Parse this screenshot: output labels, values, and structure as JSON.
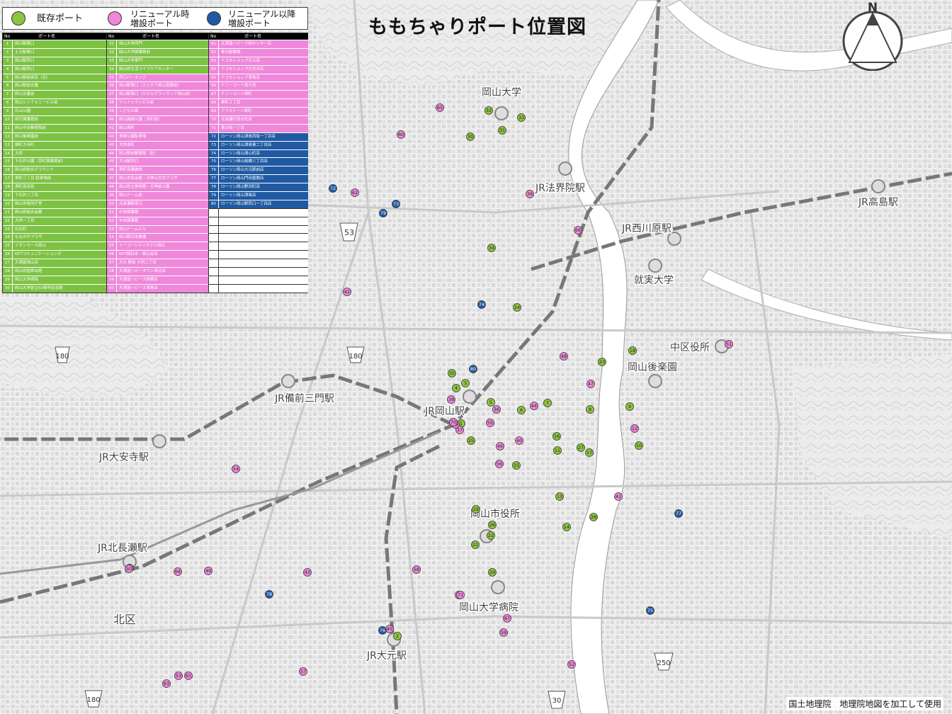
{
  "title": "ももちゃりポート位置図",
  "credit": "国土地理院　地理院地図を加工して使用",
  "legend": [
    {
      "label": "既存ポート",
      "color": "#8cc63f"
    },
    {
      "label": "リニューアル時\n増設ポート",
      "color": "#ef87da"
    },
    {
      "label": "リニューアル以降\n増設ポート",
      "color": "#1f5aa3"
    }
  ],
  "compass_letter": "N",
  "table_header": {
    "no": "No",
    "name": "ポート名"
  },
  "table": {
    "col1": [
      {
        "no": "1",
        "name": "岡山駅東口",
        "c": "green"
      },
      {
        "no": "2",
        "name": "土元駅東口",
        "c": "green"
      },
      {
        "no": "3",
        "name": "岡山駅西口",
        "c": "green"
      },
      {
        "no": "4",
        "name": "岡山駅西口",
        "c": "green"
      },
      {
        "no": "5",
        "name": "岡山駅前商店（北）",
        "c": "green"
      },
      {
        "no": "6",
        "name": "岡山駅前交番",
        "c": "green"
      },
      {
        "no": "7",
        "name": "岡山交番前",
        "c": "green"
      },
      {
        "no": "8",
        "name": "岡山シンフォニービル前",
        "c": "green"
      },
      {
        "no": "9",
        "name": "石山公園",
        "c": "green"
      },
      {
        "no": "10",
        "name": "県庁図書館前",
        "c": "green"
      },
      {
        "no": "11",
        "name": "岡山中央郵便局前",
        "c": "green"
      },
      {
        "no": "12",
        "name": "岡山後楽園前",
        "c": "green"
      },
      {
        "no": "13",
        "name": "柳町大寺町",
        "c": "green"
      },
      {
        "no": "14",
        "name": "大供",
        "c": "green"
      },
      {
        "no": "15",
        "name": "下石井公園（幸町図書館前）",
        "c": "green"
      },
      {
        "no": "16",
        "name": "岡山県総合グラウンド",
        "c": "green"
      },
      {
        "no": "17",
        "name": "表町三丁目 駐車場前",
        "c": "green"
      },
      {
        "no": "18",
        "name": "表町商店街",
        "c": "green"
      },
      {
        "no": "19",
        "name": "下石井二丁目",
        "c": "green"
      },
      {
        "no": "20",
        "name": "岡山市役所庁舎",
        "c": "green"
      },
      {
        "no": "21",
        "name": "岡山県総合会館",
        "c": "green"
      },
      {
        "no": "22",
        "name": "大供一丁目",
        "c": "green"
      },
      {
        "no": "23",
        "name": "石石町",
        "c": "green"
      },
      {
        "no": "24",
        "name": "もものやプラザ",
        "c": "green"
      },
      {
        "no": "25",
        "name": "イオンモール岡山",
        "c": "green"
      },
      {
        "no": "26",
        "name": "NTTコミュニケーションズ",
        "c": "green"
      },
      {
        "no": "27",
        "name": "天満屋岡山店",
        "c": "green"
      },
      {
        "no": "28",
        "name": "岡山県医師会館",
        "c": "green"
      },
      {
        "no": "29",
        "name": "岡山大学病院",
        "c": "green"
      },
      {
        "no": "30",
        "name": "岡山大学創立50周年記念館",
        "c": "green"
      }
    ],
    "col2": [
      {
        "no": "31",
        "name": "岡山大学西門",
        "c": "green"
      },
      {
        "no": "32",
        "name": "岡山大学図書館前",
        "c": "green"
      },
      {
        "no": "33",
        "name": "岡山大学東門",
        "c": "green"
      },
      {
        "no": "34",
        "name": "岡山県生活ライフケアセンター",
        "c": "green"
      },
      {
        "no": "35",
        "name": "西口パーキング",
        "c": "pink"
      },
      {
        "no": "36",
        "name": "岡山駅東口（さんすて岡山南館前）",
        "c": "pink"
      },
      {
        "no": "37",
        "name": "岡山駅東口（ホテルグランヴィア岡山前）",
        "c": "pink"
      },
      {
        "no": "38",
        "name": "ワットシティビル前",
        "c": "pink"
      },
      {
        "no": "39",
        "name": "こどもの森",
        "c": "pink"
      },
      {
        "no": "40",
        "name": "岡山城緑公園（本町前）",
        "c": "pink"
      },
      {
        "no": "41",
        "name": "岡山表町",
        "c": "pink"
      },
      {
        "no": "42",
        "name": "鳥城公園駐車場",
        "c": "pink"
      },
      {
        "no": "43",
        "name": "大供本町",
        "c": "pink"
      },
      {
        "no": "44",
        "name": "岡山駅前郵便局（岩）",
        "c": "pink"
      },
      {
        "no": "45",
        "name": "大元駅西口",
        "c": "pink"
      },
      {
        "no": "46",
        "name": "表町商業施設",
        "c": "pink"
      },
      {
        "no": "47",
        "name": "岡山市民会館・天神山文化プラザ",
        "c": "pink"
      },
      {
        "no": "48",
        "name": "岡山県立美術館・天神前公園",
        "c": "pink"
      },
      {
        "no": "49",
        "name": "岡山ドーム前",
        "c": "pink"
      },
      {
        "no": "50",
        "name": "北長瀬駅南口",
        "c": "pink"
      },
      {
        "no": "51",
        "name": "中原図書館",
        "c": "pink"
      },
      {
        "no": "52",
        "name": "中央図書館",
        "c": "pink"
      },
      {
        "no": "53",
        "name": "岡山ドームビル",
        "c": "pink"
      },
      {
        "no": "54",
        "name": "岡山駅日本郵便",
        "c": "pink"
      },
      {
        "no": "55",
        "name": "トーコーシティホテル岡山",
        "c": "pink"
      },
      {
        "no": "56",
        "name": "NTT岡日本・岡山支店",
        "c": "pink"
      },
      {
        "no": "57",
        "name": "大元 駅前 大供二丁目",
        "c": "pink"
      },
      {
        "no": "58",
        "name": "天満屋ハピータウン岡北店",
        "c": "pink"
      },
      {
        "no": "59",
        "name": "天満屋ハピーズ岡輝店",
        "c": "pink"
      },
      {
        "no": "60",
        "name": "天満屋ハピーズ津島店",
        "c": "pink"
      }
    ],
    "col3": [
      {
        "no": "61",
        "name": "天満屋ハピーズ岡センター店",
        "c": "pink"
      },
      {
        "no": "62",
        "name": "奉日駐輪場",
        "c": "pink"
      },
      {
        "no": "63",
        "name": "ドコモショップ大元店",
        "c": "pink"
      },
      {
        "no": "64",
        "name": "ドコモショップ大安寺店",
        "c": "pink"
      },
      {
        "no": "65",
        "name": "ドコモショップ津島店",
        "c": "pink"
      },
      {
        "no": "66",
        "name": "テニーコート南大供",
        "c": "pink"
      },
      {
        "no": "67",
        "name": "テニーコート岡町",
        "c": "pink"
      },
      {
        "no": "68",
        "name": "奉町２丁目",
        "c": "pink"
      },
      {
        "no": "69",
        "name": "アイステージ奉町",
        "c": "pink"
      },
      {
        "no": "70",
        "name": "北長瀬行政出先店",
        "c": "pink"
      },
      {
        "no": "71",
        "name": "東古松一丁目",
        "c": "pink"
      },
      {
        "no": "72",
        "name": "ローソン岡山津島西坂一丁目店",
        "c": "blue"
      },
      {
        "no": "73",
        "name": "ローソン岡山津島東二丁目店",
        "c": "blue"
      },
      {
        "no": "74",
        "name": "ローソン岡山清心町店",
        "c": "blue"
      },
      {
        "no": "75",
        "name": "ローソン岡山桜橋三丁目店",
        "c": "blue"
      },
      {
        "no": "76",
        "name": "ローソン岡山大元駅前店",
        "c": "blue"
      },
      {
        "no": "77",
        "name": "ローソン岡山門田屋敷店",
        "c": "blue"
      },
      {
        "no": "78",
        "name": "ローソン岡山野田町店",
        "c": "blue"
      },
      {
        "no": "79",
        "name": "ローソン岡山津島店",
        "c": "blue"
      },
      {
        "no": "80",
        "name": "ローソン岡山駅西口一丁目店",
        "c": "blue"
      },
      {
        "no": "",
        "name": "",
        "c": "empty"
      },
      {
        "no": "",
        "name": "",
        "c": "empty"
      },
      {
        "no": "",
        "name": "",
        "c": "empty"
      },
      {
        "no": "",
        "name": "",
        "c": "empty"
      },
      {
        "no": "",
        "name": "",
        "c": "empty"
      },
      {
        "no": "",
        "name": "",
        "c": "empty"
      },
      {
        "no": "",
        "name": "",
        "c": "empty"
      },
      {
        "no": "",
        "name": "",
        "c": "empty"
      },
      {
        "no": "",
        "name": "",
        "c": "empty"
      },
      {
        "no": "",
        "name": "",
        "c": "empty"
      }
    ]
  },
  "stations": [
    {
      "name": "JR岡山駅"
    },
    {
      "name": "JR法界院駅"
    },
    {
      "name": "JR高島駅"
    },
    {
      "name": "JR西川原駅"
    },
    {
      "name": "JR備前三門駅"
    },
    {
      "name": "JR大安寺駅"
    },
    {
      "name": "JR北長瀬駅"
    },
    {
      "name": "JR大元駅"
    }
  ],
  "landmarks": [
    {
      "name": "岡山大学"
    },
    {
      "name": "就実大学"
    },
    {
      "name": "中区役所"
    },
    {
      "name": "岡山後楽園"
    },
    {
      "name": "岡山市役所"
    },
    {
      "name": "岡山大学病院"
    },
    {
      "name": "北区"
    }
  ],
  "route_signs": [
    "53",
    "180",
    "180",
    "180",
    "250",
    "30"
  ],
  "ports": [
    {
      "n": "1",
      "c": "green"
    },
    {
      "n": "2",
      "c": "green"
    },
    {
      "n": "3",
      "c": "green"
    },
    {
      "n": "4",
      "c": "green"
    },
    {
      "n": "5",
      "c": "green"
    },
    {
      "n": "6",
      "c": "green"
    },
    {
      "n": "7",
      "c": "green"
    },
    {
      "n": "8",
      "c": "green"
    },
    {
      "n": "9",
      "c": "green"
    },
    {
      "n": "10",
      "c": "green"
    },
    {
      "n": "11",
      "c": "green"
    },
    {
      "n": "12",
      "c": "pink"
    },
    {
      "n": "13",
      "c": "green"
    },
    {
      "n": "14",
      "c": "green"
    },
    {
      "n": "15",
      "c": "green"
    },
    {
      "n": "16",
      "c": "green"
    },
    {
      "n": "17",
      "c": "green"
    },
    {
      "n": "18",
      "c": "green"
    },
    {
      "n": "19",
      "c": "green"
    },
    {
      "n": "20",
      "c": "green"
    },
    {
      "n": "21",
      "c": "green"
    },
    {
      "n": "22",
      "c": "green"
    },
    {
      "n": "23",
      "c": "green"
    },
    {
      "n": "24",
      "c": "green"
    },
    {
      "n": "25",
      "c": "green"
    },
    {
      "n": "26",
      "c": "green"
    },
    {
      "n": "27",
      "c": "green"
    },
    {
      "n": "28",
      "c": "green"
    },
    {
      "n": "29",
      "c": "green"
    },
    {
      "n": "30",
      "c": "green"
    },
    {
      "n": "31",
      "c": "green"
    },
    {
      "n": "32",
      "c": "green"
    },
    {
      "n": "33",
      "c": "green"
    },
    {
      "n": "34",
      "c": "green"
    },
    {
      "n": "35",
      "c": "green"
    },
    {
      "n": "36",
      "c": "pink"
    },
    {
      "n": "37",
      "c": "pink"
    },
    {
      "n": "38",
      "c": "pink"
    },
    {
      "n": "39",
      "c": "pink"
    },
    {
      "n": "40",
      "c": "pink"
    },
    {
      "n": "41",
      "c": "pink"
    },
    {
      "n": "42",
      "c": "pink"
    },
    {
      "n": "43",
      "c": "pink"
    },
    {
      "n": "44",
      "c": "pink"
    },
    {
      "n": "45",
      "c": "pink"
    },
    {
      "n": "46",
      "c": "pink"
    },
    {
      "n": "47",
      "c": "pink"
    },
    {
      "n": "48",
      "c": "pink"
    },
    {
      "n": "49",
      "c": "pink"
    },
    {
      "n": "50",
      "c": "pink"
    },
    {
      "n": "51",
      "c": "pink"
    },
    {
      "n": "52",
      "c": "pink"
    },
    {
      "n": "53",
      "c": "pink"
    },
    {
      "n": "54",
      "c": "pink"
    },
    {
      "n": "55",
      "c": "pink"
    },
    {
      "n": "56",
      "c": "pink"
    },
    {
      "n": "57",
      "c": "pink"
    },
    {
      "n": "58",
      "c": "pink"
    },
    {
      "n": "59",
      "c": "pink"
    },
    {
      "n": "60",
      "c": "pink"
    },
    {
      "n": "61",
      "c": "pink"
    },
    {
      "n": "62",
      "c": "pink"
    },
    {
      "n": "63",
      "c": "pink"
    },
    {
      "n": "64",
      "c": "pink"
    },
    {
      "n": "65",
      "c": "pink"
    },
    {
      "n": "66",
      "c": "pink"
    },
    {
      "n": "67",
      "c": "pink"
    },
    {
      "n": "68",
      "c": "pink"
    },
    {
      "n": "69",
      "c": "pink"
    },
    {
      "n": "70",
      "c": "pink"
    },
    {
      "n": "71",
      "c": "pink"
    },
    {
      "n": "72",
      "c": "blue"
    },
    {
      "n": "73",
      "c": "blue"
    },
    {
      "n": "74",
      "c": "blue"
    },
    {
      "n": "75",
      "c": "blue"
    },
    {
      "n": "76",
      "c": "blue"
    },
    {
      "n": "77",
      "c": "blue"
    },
    {
      "n": "78",
      "c": "blue"
    },
    {
      "n": "79",
      "c": "blue"
    },
    {
      "n": "80",
      "c": "blue"
    }
  ]
}
